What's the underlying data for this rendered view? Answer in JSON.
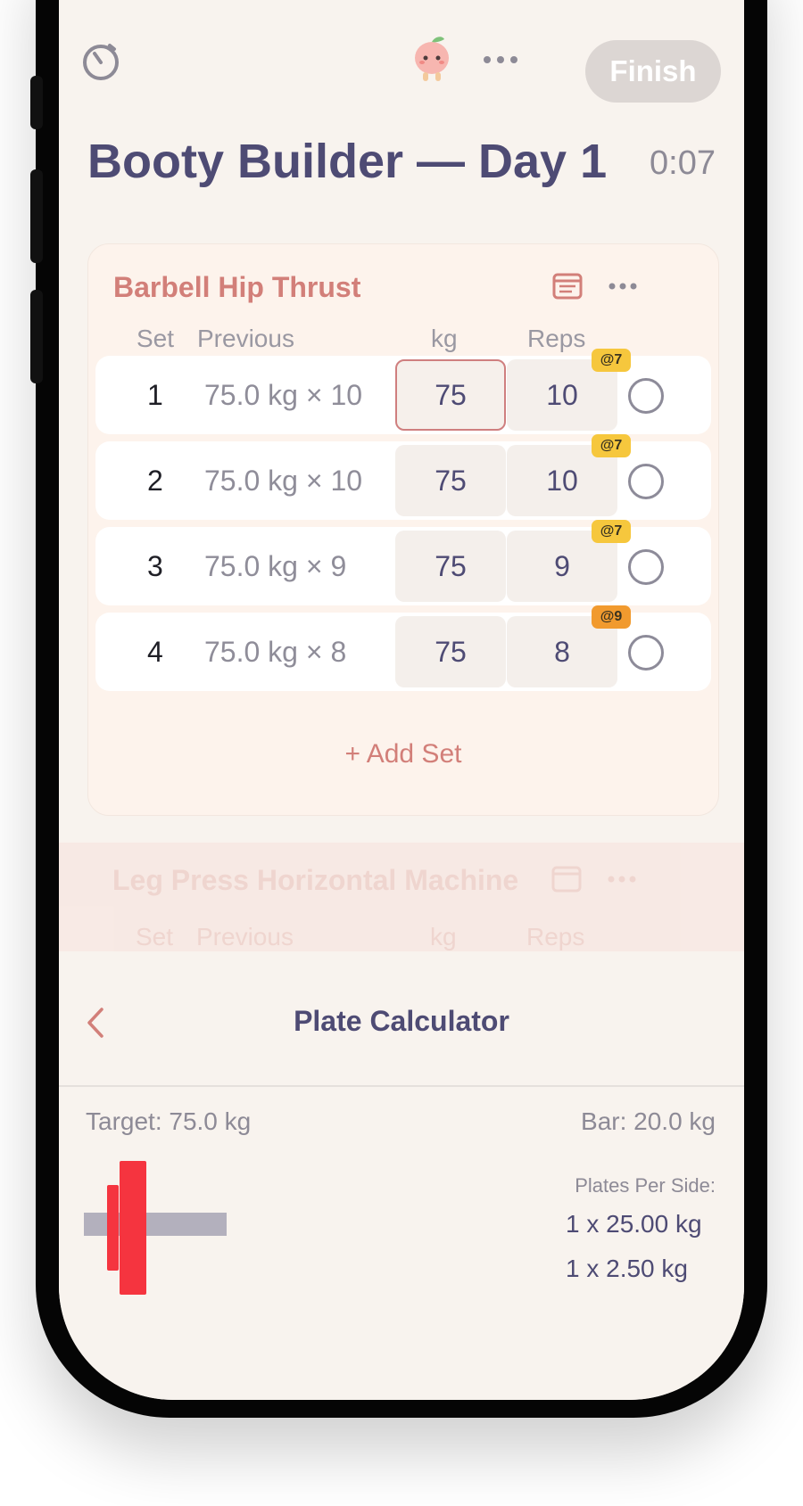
{
  "header": {
    "timer_icon": "stopwatch-icon",
    "mascot_icon": "peach-mascot-icon",
    "more_icon": "more-horizontal-icon",
    "finish_label": "Finish"
  },
  "workout": {
    "title": "Booty Builder — Day 1",
    "elapsed": "0:07"
  },
  "exercise": {
    "name": "Barbell Hip Thrust",
    "columns": {
      "set": "Set",
      "previous": "Previous",
      "kg": "kg",
      "reps": "Reps"
    },
    "sets": [
      {
        "num": "1",
        "previous": "75.0 kg × 10",
        "kg": "75",
        "reps": "10",
        "rpe": "@7",
        "rpe_color": "#f6c73d"
      },
      {
        "num": "2",
        "previous": "75.0 kg × 10",
        "kg": "75",
        "reps": "10",
        "rpe": "@7",
        "rpe_color": "#f6c73d"
      },
      {
        "num": "3",
        "previous": "75.0 kg × 9",
        "kg": "75",
        "reps": "9",
        "rpe": "@7",
        "rpe_color": "#f6c73d"
      },
      {
        "num": "4",
        "previous": "75.0 kg × 8",
        "kg": "75",
        "reps": "8",
        "rpe": "@9",
        "rpe_color": "#f19a2e"
      }
    ],
    "add_set_label": "+ Add Set"
  },
  "next_exercise": {
    "name": "Leg Press Horizontal Machine",
    "columns": {
      "set": "Set",
      "previous": "Previous",
      "kg": "kg",
      "reps": "Reps"
    }
  },
  "plate_calculator": {
    "title": "Plate Calculator",
    "target": "Target: 75.0 kg",
    "bar": "Bar: 20.0 kg",
    "per_side_label": "Plates Per Side:",
    "plates": [
      "1 x 25.00 kg",
      "1 x 2.50 kg"
    ]
  },
  "colors": {
    "accent": "#d27f79",
    "title": "#4e4b74",
    "plate": "#f5343f",
    "bar": "#b3b0bd"
  }
}
